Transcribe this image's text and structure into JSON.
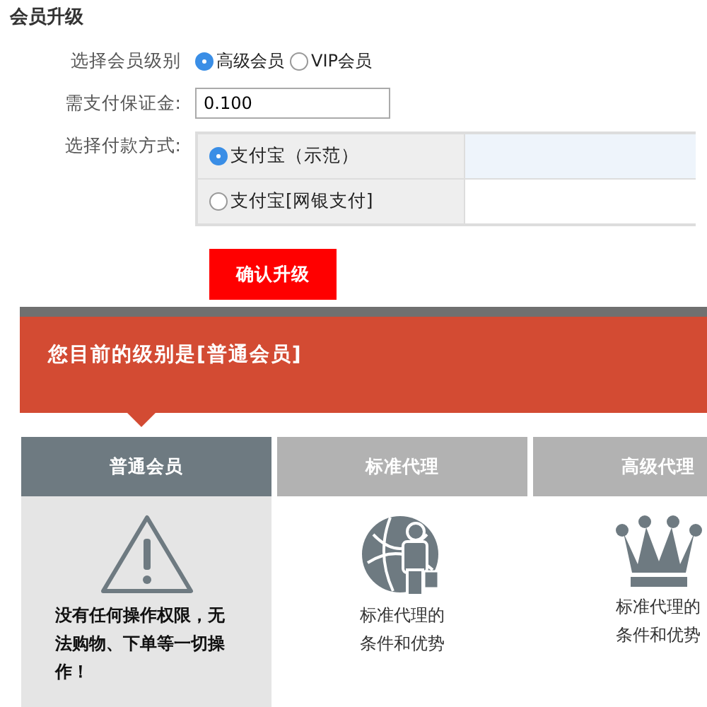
{
  "page_title": "会员升级",
  "level_field": {
    "label": "选择会员级别",
    "options": [
      {
        "label": "高级会员",
        "selected": true
      },
      {
        "label": "VIP会员",
        "selected": false
      }
    ]
  },
  "deposit_field": {
    "label": "需支付保证金:",
    "value": "0.100"
  },
  "payment_field": {
    "label": "选择付款方式:",
    "options": [
      {
        "label": "支付宝（示范）",
        "selected": true
      },
      {
        "label": "支付宝[网银支付]",
        "selected": false
      }
    ]
  },
  "confirm_button": "确认升级",
  "current_level_banner": "您目前的级别是[普通会员]",
  "tiers": [
    {
      "name": "普通会员",
      "selected": true,
      "kind": "warning",
      "description": "没有任何操作权限，无法购物、下单等一切操作！"
    },
    {
      "name": "标准代理",
      "selected": false,
      "kind": "agent",
      "description": "标准代理的条件和优势"
    },
    {
      "name": "高级代理",
      "selected": false,
      "kind": "crown",
      "description": "标准代理的条件和优势"
    }
  ]
}
